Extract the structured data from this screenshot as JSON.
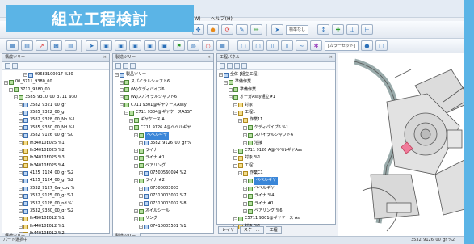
{
  "badge": "組立工程検討",
  "menu": [
    "ウ(W)",
    "ヘルプ(H)"
  ],
  "toolbar": {
    "view_select": "標準なし",
    "layer_select": "[カラーセット]"
  },
  "panels": {
    "structure": {
      "title": "構成ツリー",
      "tab": "構成ツリー",
      "rows": [
        {
          "text": "09683100017 %30",
          "lv": 4,
          "icon": "b"
        },
        {
          "text": "00_3711_9380_00",
          "lv": 0,
          "icon": "g"
        },
        {
          "text": "3711_9380_00",
          "lv": 1,
          "icon": "g"
        },
        {
          "text": "3585_9310_00_3711_930",
          "lv": 2,
          "icon": "g"
        },
        {
          "text": "2582_9321_00_gr",
          "lv": 3,
          "icon": "b"
        },
        {
          "text": "3585_9322_00_gr",
          "lv": 3,
          "icon": "b"
        },
        {
          "text": "3582_9328_00_Nb %1",
          "lv": 3,
          "icon": "b"
        },
        {
          "text": "3585_9330_00_Nd %1",
          "lv": 3,
          "icon": "b"
        },
        {
          "text": "3582_9126_00_gr %0",
          "lv": 3,
          "icon": "b"
        },
        {
          "text": "lh34010E025 %1",
          "lv": 3,
          "icon": "y"
        },
        {
          "text": "lh34010E025 %2",
          "lv": 3,
          "icon": "y"
        },
        {
          "text": "lh34010E025 %3",
          "lv": 3,
          "icon": "y"
        },
        {
          "text": "lh34010E025 %4",
          "lv": 3,
          "icon": "y"
        },
        {
          "text": "4125_1124_00_gr %2",
          "lv": 3,
          "icon": "b"
        },
        {
          "text": "4125_1124_00_gr %2",
          "lv": 3,
          "icon": "b"
        },
        {
          "text": "3532_9127_0w_cov %",
          "lv": 3,
          "icon": "b"
        },
        {
          "text": "3532_9125_00_gr %1",
          "lv": 3,
          "icon": "b"
        },
        {
          "text": "3532_9128_00_nd %1",
          "lv": 3,
          "icon": "b"
        },
        {
          "text": "3532_9380_00_gr %2",
          "lv": 3,
          "icon": "b"
        },
        {
          "text": "lh49010E012 %1",
          "lv": 3,
          "icon": "y"
        },
        {
          "text": "lh44010E012 %1",
          "lv": 3,
          "icon": "y"
        },
        {
          "text": "lh44010E012 %2",
          "lv": 3,
          "icon": "y"
        }
      ]
    },
    "assembly": {
      "title": "製造ツリー",
      "tab": "製造ツリー",
      "rows": [
        {
          "text": "製品ツリー",
          "lv": 0,
          "icon": "b"
        },
        {
          "text": "スパイラルシャフト6",
          "lv": 1,
          "icon": "g"
        },
        {
          "text": "(W)ケディパイプ6",
          "lv": 1,
          "icon": "g"
        },
        {
          "text": "(W)スパイラルシャフト6",
          "lv": 1,
          "icon": "g"
        },
        {
          "text": "C711 9301@ギヤケースAssy",
          "lv": 1,
          "icon": "g"
        },
        {
          "text": "C711 9304@ギヤケースASSY",
          "lv": 2,
          "icon": "g"
        },
        {
          "text": "ギヤケース A",
          "lv": 3,
          "icon": "g"
        },
        {
          "text": "C711 9126 A@ベベルギヤ",
          "lv": 3,
          "icon": "g"
        },
        {
          "text": "ベベルギヤ",
          "lv": 4,
          "icon": "g",
          "sel": true
        },
        {
          "text": "3582_9126_00_gr %",
          "lv": 5,
          "icon": "b"
        },
        {
          "text": "ライナ",
          "lv": 4,
          "icon": "g"
        },
        {
          "text": "ライナ #1",
          "lv": 4,
          "icon": "g"
        },
        {
          "text": "ベアリング",
          "lv": 4,
          "icon": "g"
        },
        {
          "text": "07500560094 %2",
          "lv": 5,
          "icon": "b"
        },
        {
          "text": "ライナ #2",
          "lv": 4,
          "icon": "g"
        },
        {
          "text": "07300003003",
          "lv": 5,
          "icon": "b"
        },
        {
          "text": "07310003002 %7",
          "lv": 5,
          "icon": "b"
        },
        {
          "text": "07310003002 %8",
          "lv": 5,
          "icon": "b"
        },
        {
          "text": "オイルシール",
          "lv": 4,
          "icon": "g"
        },
        {
          "text": "リング",
          "lv": 4,
          "icon": "g"
        },
        {
          "text": "07410005501 %1",
          "lv": 5,
          "icon": "b"
        }
      ]
    },
    "process": {
      "title": "工程パネル",
      "tab": "",
      "rows": [
        {
          "text": "全体 [組立工程]",
          "lv": 0,
          "icon": "b"
        },
        {
          "text": "準備作業",
          "lv": 1,
          "icon": "g"
        },
        {
          "text": "準備作業",
          "lv": 2,
          "icon": "g"
        },
        {
          "text": "オーガAssy組立#1",
          "lv": 2,
          "icon": "g"
        },
        {
          "text": "対象",
          "lv": 3,
          "icon": "y"
        },
        {
          "text": "工程1",
          "lv": 3,
          "icon": "y"
        },
        {
          "text": "作業11",
          "lv": 4,
          "icon": "y"
        },
        {
          "text": "ケディパイプ6 %1",
          "lv": 5,
          "icon": "g"
        },
        {
          "text": "スパイラルシャフト6",
          "lv": 5,
          "icon": "g"
        },
        {
          "text": "溶接",
          "lv": 5,
          "icon": "g"
        },
        {
          "text": "C711 9126 A@ベベルギヤAss",
          "lv": 3,
          "icon": "g"
        },
        {
          "text": "対象 %1",
          "lv": 3,
          "icon": "y"
        },
        {
          "text": "工程1",
          "lv": 3,
          "icon": "y"
        },
        {
          "text": "作業C1",
          "lv": 4,
          "icon": "y"
        },
        {
          "text": "ベベルギヤ",
          "lv": 5,
          "icon": "g",
          "sel": true
        },
        {
          "text": "ベベルギヤ",
          "lv": 5,
          "icon": "g"
        },
        {
          "text": "ライナ %4",
          "lv": 5,
          "icon": "g"
        },
        {
          "text": "ライナ #1",
          "lv": 5,
          "icon": "g"
        },
        {
          "text": "ベアリング %6",
          "lv": 5,
          "icon": "g"
        },
        {
          "text": "C5711 9301@ギヤケース As",
          "lv": 3,
          "icon": "g"
        },
        {
          "text": "対象 %1",
          "lv": 3,
          "icon": "y"
        }
      ]
    }
  },
  "bottom_tabs": [
    "レイヤ",
    "スケー...",
    "工程"
  ],
  "status": {
    "left": "パート選択中",
    "right": "3532_9126_00_gr %2"
  }
}
